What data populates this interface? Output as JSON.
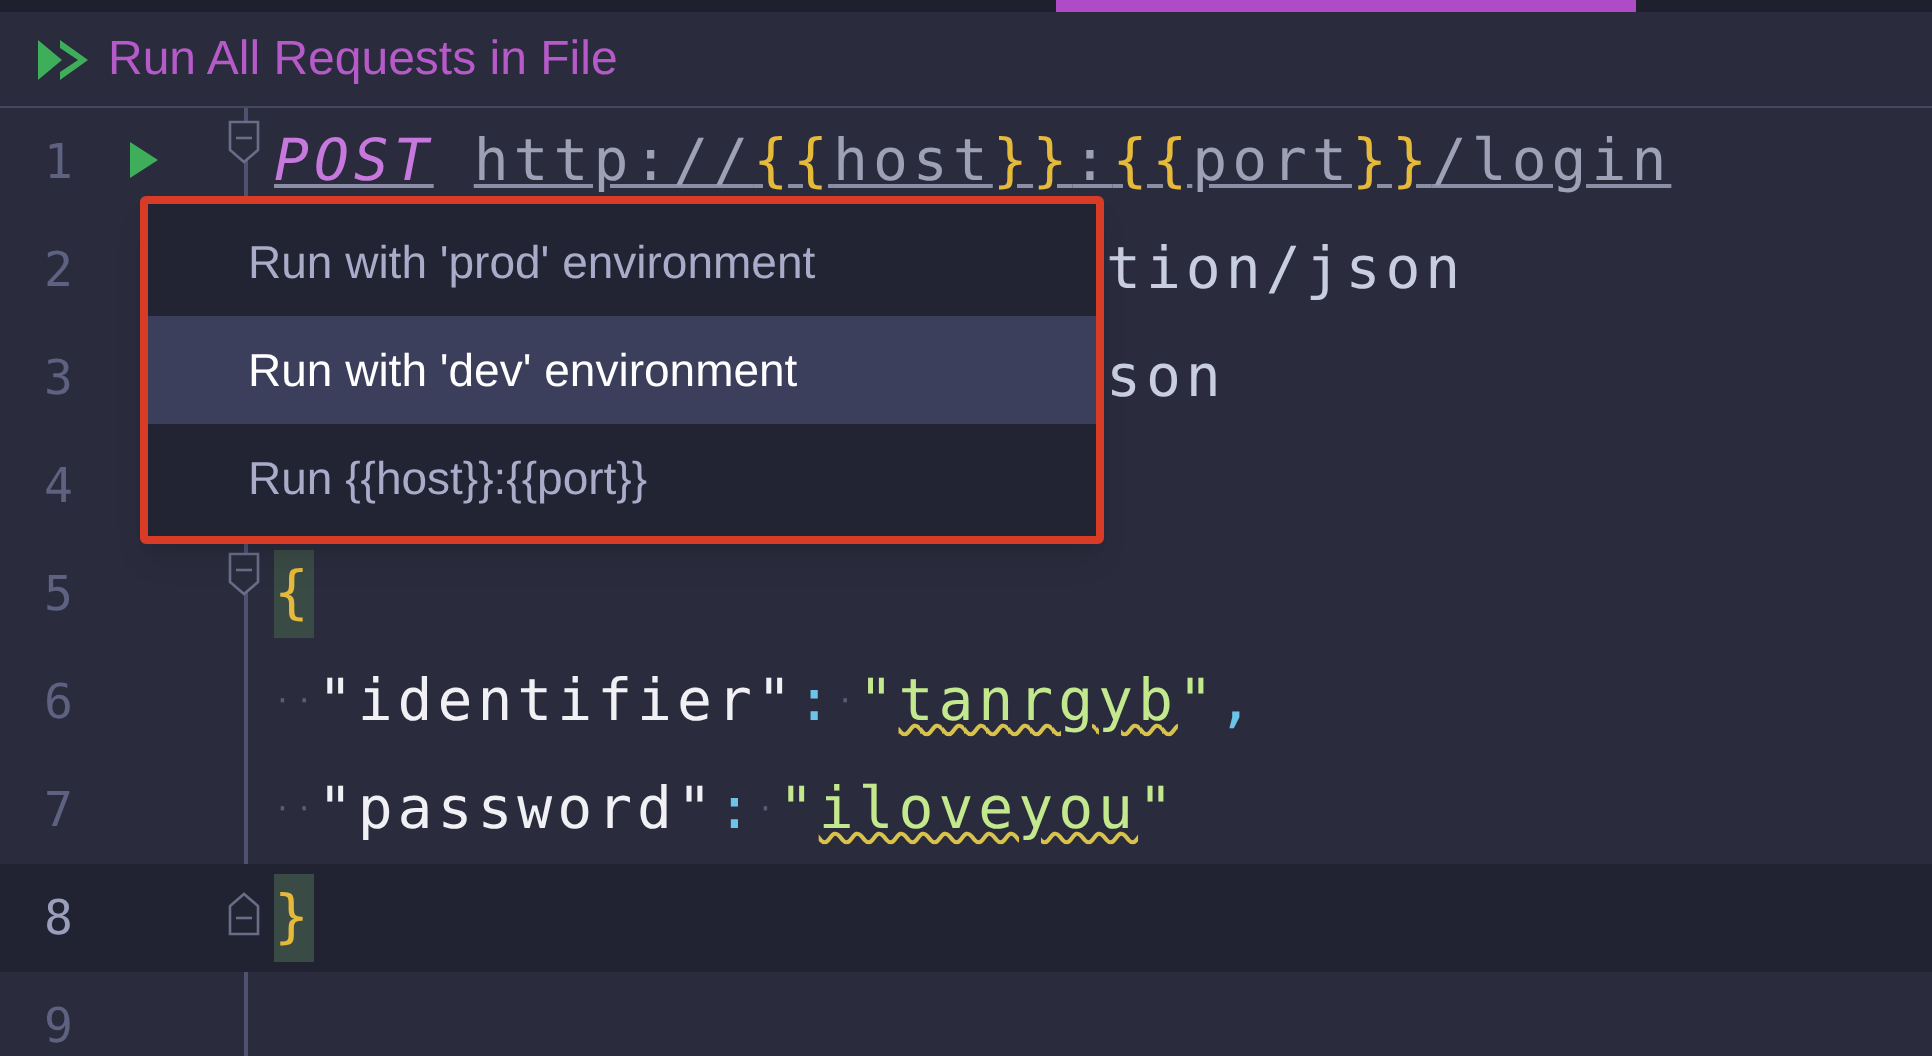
{
  "toolbar": {
    "label": "Run All Requests in File"
  },
  "popup": {
    "items": [
      {
        "label": "Run with 'prod' environment",
        "selected": false
      },
      {
        "label": "Run with 'dev' environment",
        "selected": true
      },
      {
        "label": "Run {{host}}:{{port}}",
        "selected": false
      }
    ]
  },
  "editor": {
    "lines": [
      {
        "number": "1",
        "current": false,
        "run": true,
        "fold": {
          "kind": "start"
        },
        "kind": "normal",
        "tokens": [
          {
            "text": "POST",
            "kind": "method"
          },
          {
            "text": "http://",
            "kind": "url"
          },
          {
            "text": "{{",
            "kind": "brace"
          },
          {
            "text": "host",
            "kind": "url"
          },
          {
            "text": "}}",
            "kind": "brace"
          },
          {
            "text": ":",
            "kind": "url"
          },
          {
            "text": "{{",
            "kind": "brace"
          },
          {
            "text": "port",
            "kind": "url"
          },
          {
            "text": "}}",
            "kind": "brace"
          },
          {
            "text": "/login",
            "kind": "url"
          }
        ]
      },
      {
        "number": "2",
        "current": false,
        "run": false,
        "kind": "covered",
        "tokens": [
          {
            "text": "tion/json",
            "kind": "plain"
          }
        ]
      },
      {
        "number": "3",
        "current": false,
        "run": false,
        "kind": "covered",
        "tokens": [
          {
            "text": "son",
            "kind": "plain"
          }
        ]
      },
      {
        "number": "4",
        "current": false,
        "run": false,
        "kind": "normal"
      },
      {
        "number": "5",
        "current": false,
        "run": false,
        "fold": {
          "kind": "start"
        },
        "kind": "normal",
        "tokens": [
          {
            "text": "{",
            "kind": "brace-match"
          }
        ]
      },
      {
        "number": "6",
        "current": false,
        "run": false,
        "kind": "normal",
        "tokens": [
          {
            "text": "··",
            "kind": "whitespace"
          },
          {
            "text": "\"identifier\"",
            "kind": "key"
          },
          {
            "text": ":",
            "kind": "punct"
          },
          {
            "text": "·",
            "kind": "whitespace"
          },
          {
            "text": "\"",
            "kind": "string"
          },
          {
            "text": "tanrgyb",
            "kind": "typo"
          },
          {
            "text": "\"",
            "kind": "string"
          },
          {
            "text": ",",
            "kind": "punct"
          }
        ]
      },
      {
        "number": "7",
        "current": false,
        "run": false,
        "kind": "normal",
        "tokens": [
          {
            "text": "··",
            "kind": "whitespace"
          },
          {
            "text": "\"password\"",
            "kind": "key"
          },
          {
            "text": ":",
            "kind": "punct"
          },
          {
            "text": "·",
            "kind": "whitespace"
          },
          {
            "text": "\"",
            "kind": "string"
          },
          {
            "text": "iloveyou",
            "kind": "typo"
          },
          {
            "text": "\"",
            "kind": "string"
          }
        ]
      },
      {
        "number": "8",
        "current": true,
        "run": false,
        "fold": {
          "kind": "end"
        },
        "kind": "normal",
        "tokens": [
          {
            "text": "}",
            "kind": "brace-match"
          }
        ]
      },
      {
        "number": "9",
        "current": false,
        "run": false,
        "kind": "normal"
      }
    ]
  }
}
